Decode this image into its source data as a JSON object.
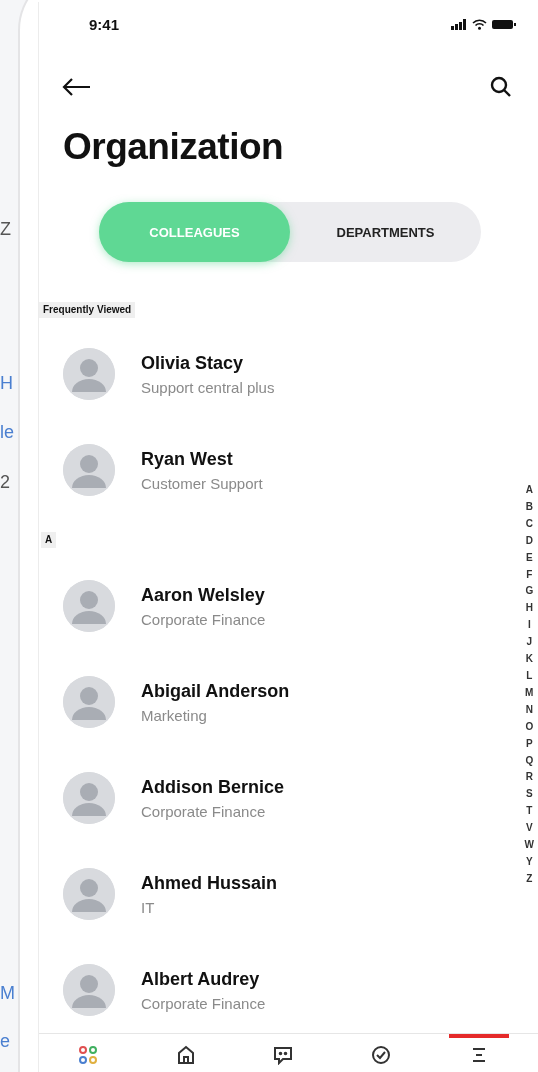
{
  "background_fragments": [
    {
      "text": "Z",
      "kind": "plain"
    },
    {
      "text": "H",
      "kind": "link"
    },
    {
      "text": "le",
      "kind": "link"
    },
    {
      "text": "2",
      "kind": "plain"
    },
    {
      "text": "M",
      "kind": "link"
    },
    {
      "text": "e",
      "kind": "link"
    }
  ],
  "status_bar": {
    "time": "9:41"
  },
  "header": {
    "title": "Organization"
  },
  "tabs": [
    {
      "label": "COLLEAGUES",
      "selected": true
    },
    {
      "label": "DEPARTMENTS",
      "selected": false
    }
  ],
  "sections": [
    {
      "heading": "Frequently Viewed",
      "people": [
        {
          "name": "Olivia Stacy",
          "role": "Support central plus"
        },
        {
          "name": "Ryan West",
          "role": "Customer Support"
        }
      ]
    },
    {
      "heading": "A",
      "people": [
        {
          "name": "Aaron Welsley",
          "role": "Corporate Finance"
        },
        {
          "name": "Abigail Anderson",
          "role": "Marketing"
        },
        {
          "name": "Addison Bernice",
          "role": "Corporate Finance"
        },
        {
          "name": "Ahmed Hussain",
          "role": "IT"
        },
        {
          "name": "Albert Audrey",
          "role": "Corporate Finance"
        }
      ]
    }
  ],
  "alphabet_index": [
    "A",
    "B",
    "C",
    "D",
    "E",
    "F",
    "G",
    "H",
    "I",
    "J",
    "K",
    "L",
    "M",
    "N",
    "O",
    "P",
    "Q",
    "R",
    "S",
    "T",
    "V",
    "W",
    "Y",
    "Z"
  ],
  "bottom_nav": [
    {
      "kind": "apps",
      "selected": false
    },
    {
      "kind": "home",
      "selected": false
    },
    {
      "kind": "chat",
      "selected": false
    },
    {
      "kind": "tasks",
      "selected": false
    },
    {
      "kind": "menu",
      "selected": true
    }
  ]
}
